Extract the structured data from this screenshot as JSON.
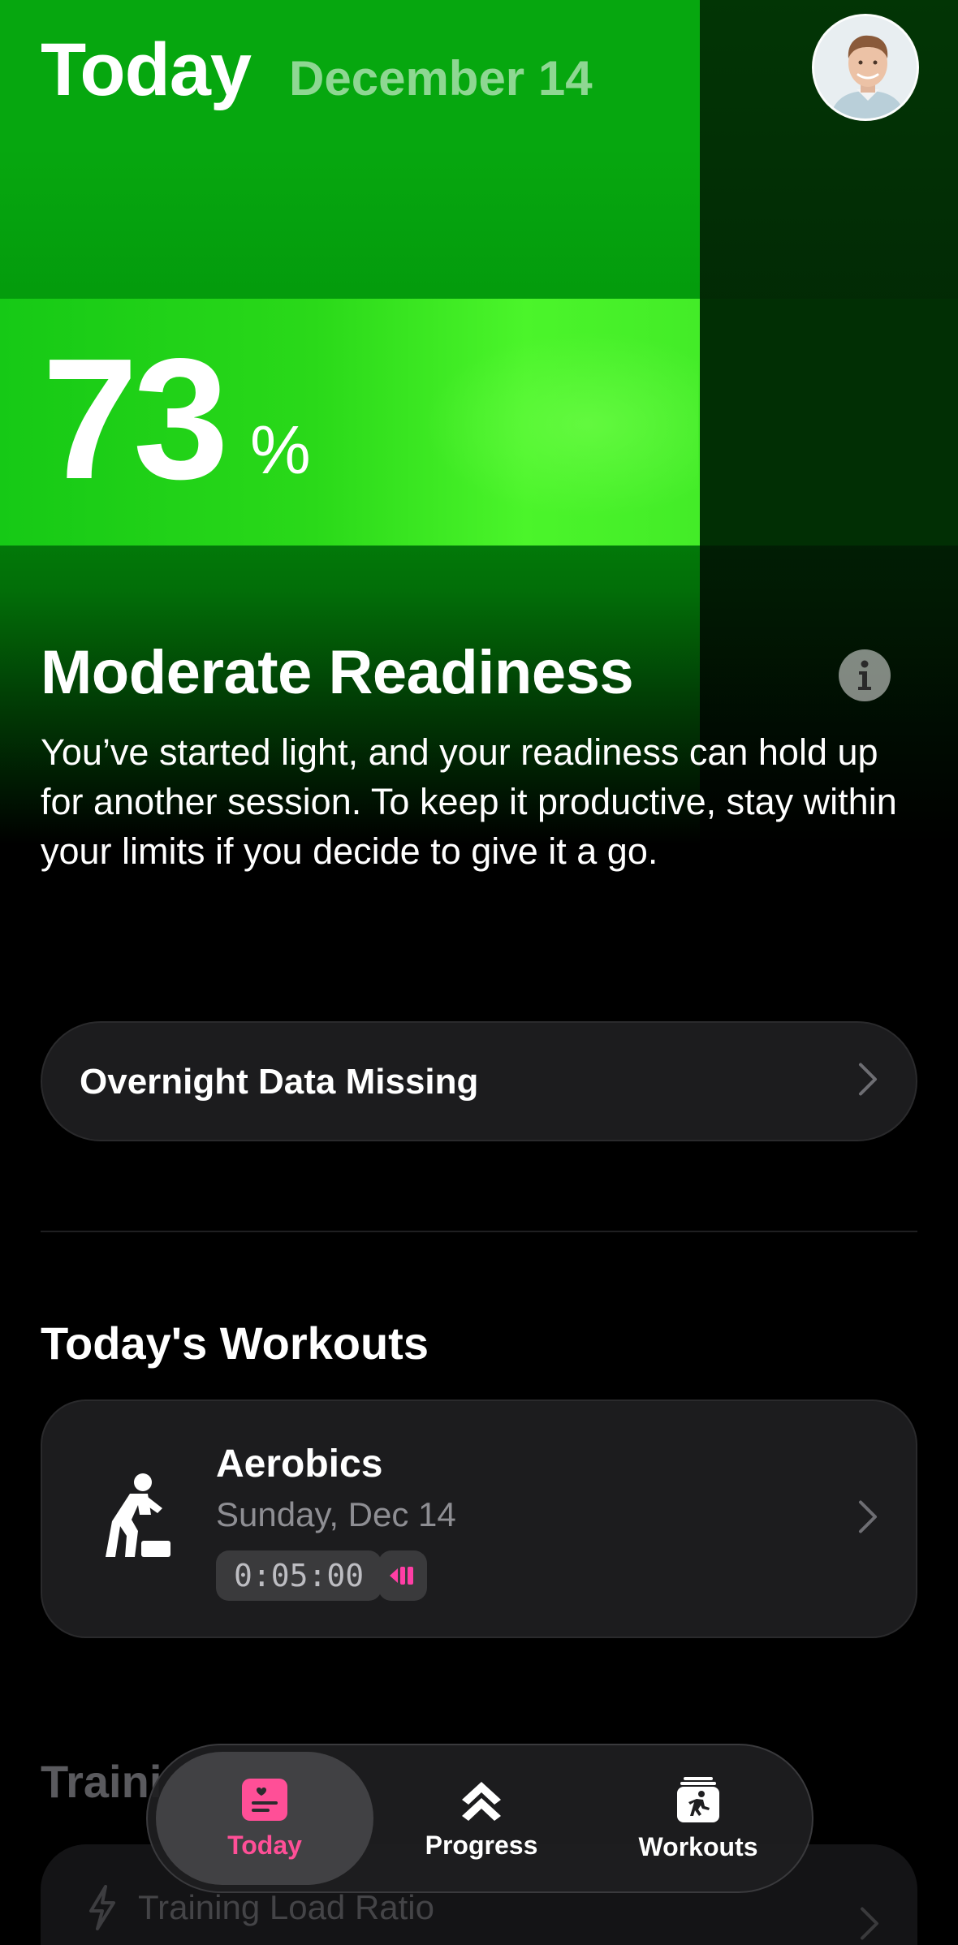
{
  "header": {
    "title": "Today",
    "date": "December 14"
  },
  "readiness": {
    "percent": "73",
    "percent_sign": "%",
    "status": "Moderate Readiness",
    "description": "You’ve started light, and your readiness can hold up for another session. To keep it productive, stay within your limits if you decide to give it a go."
  },
  "overnight": {
    "label": "Overnight Data Missing"
  },
  "workouts": {
    "title": "Today's Workouts",
    "items": [
      {
        "name": "Aerobics",
        "date": "Sunday, Dec 14",
        "duration": "0:05:00",
        "icon": "step-aerobics-icon"
      }
    ]
  },
  "training": {
    "title": "Training Balance",
    "visible_title": "Traini",
    "card_label": "Training Load Ratio"
  },
  "nav": {
    "tabs": [
      {
        "label": "Today",
        "icon": "today-heart-icon",
        "active": true
      },
      {
        "label": "Progress",
        "icon": "progress-chevrons-icon",
        "active": false
      },
      {
        "label": "Workouts",
        "icon": "workouts-runner-icon",
        "active": false
      }
    ]
  },
  "colors": {
    "accent_green": "#06a70f",
    "band_green": "#4bf52a",
    "active_tab_pink": "#ff4f97",
    "card_bg": "#1c1c1e"
  }
}
